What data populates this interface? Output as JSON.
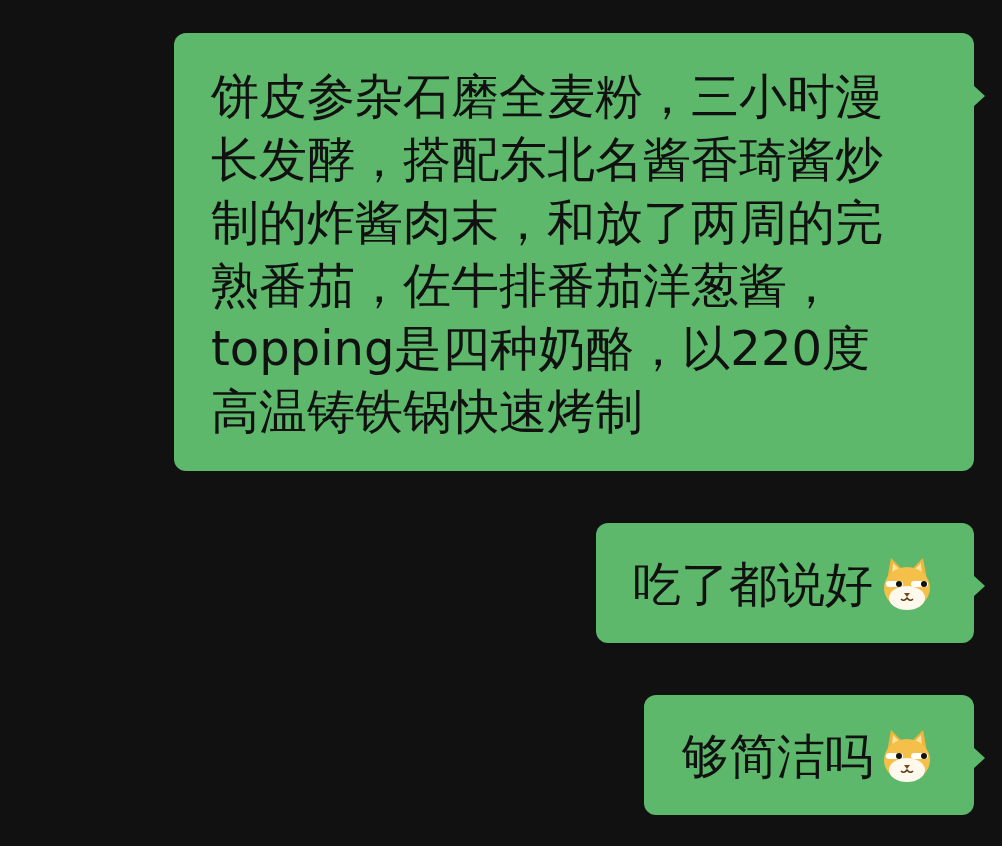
{
  "messages": [
    {
      "text": "饼皮参杂石磨全麦粉，三小时漫长发酵，搭配东北名酱香琦酱炒制的炸酱肉末，和放了两周的完熟番茄，佐牛排番茄洋葱酱，topping是四种奶酪，以220度高温铸铁锅快速烤制",
      "emoji": false
    },
    {
      "text": "吃了都说好",
      "emoji": true
    },
    {
      "text": "够简洁吗",
      "emoji": true
    }
  ]
}
